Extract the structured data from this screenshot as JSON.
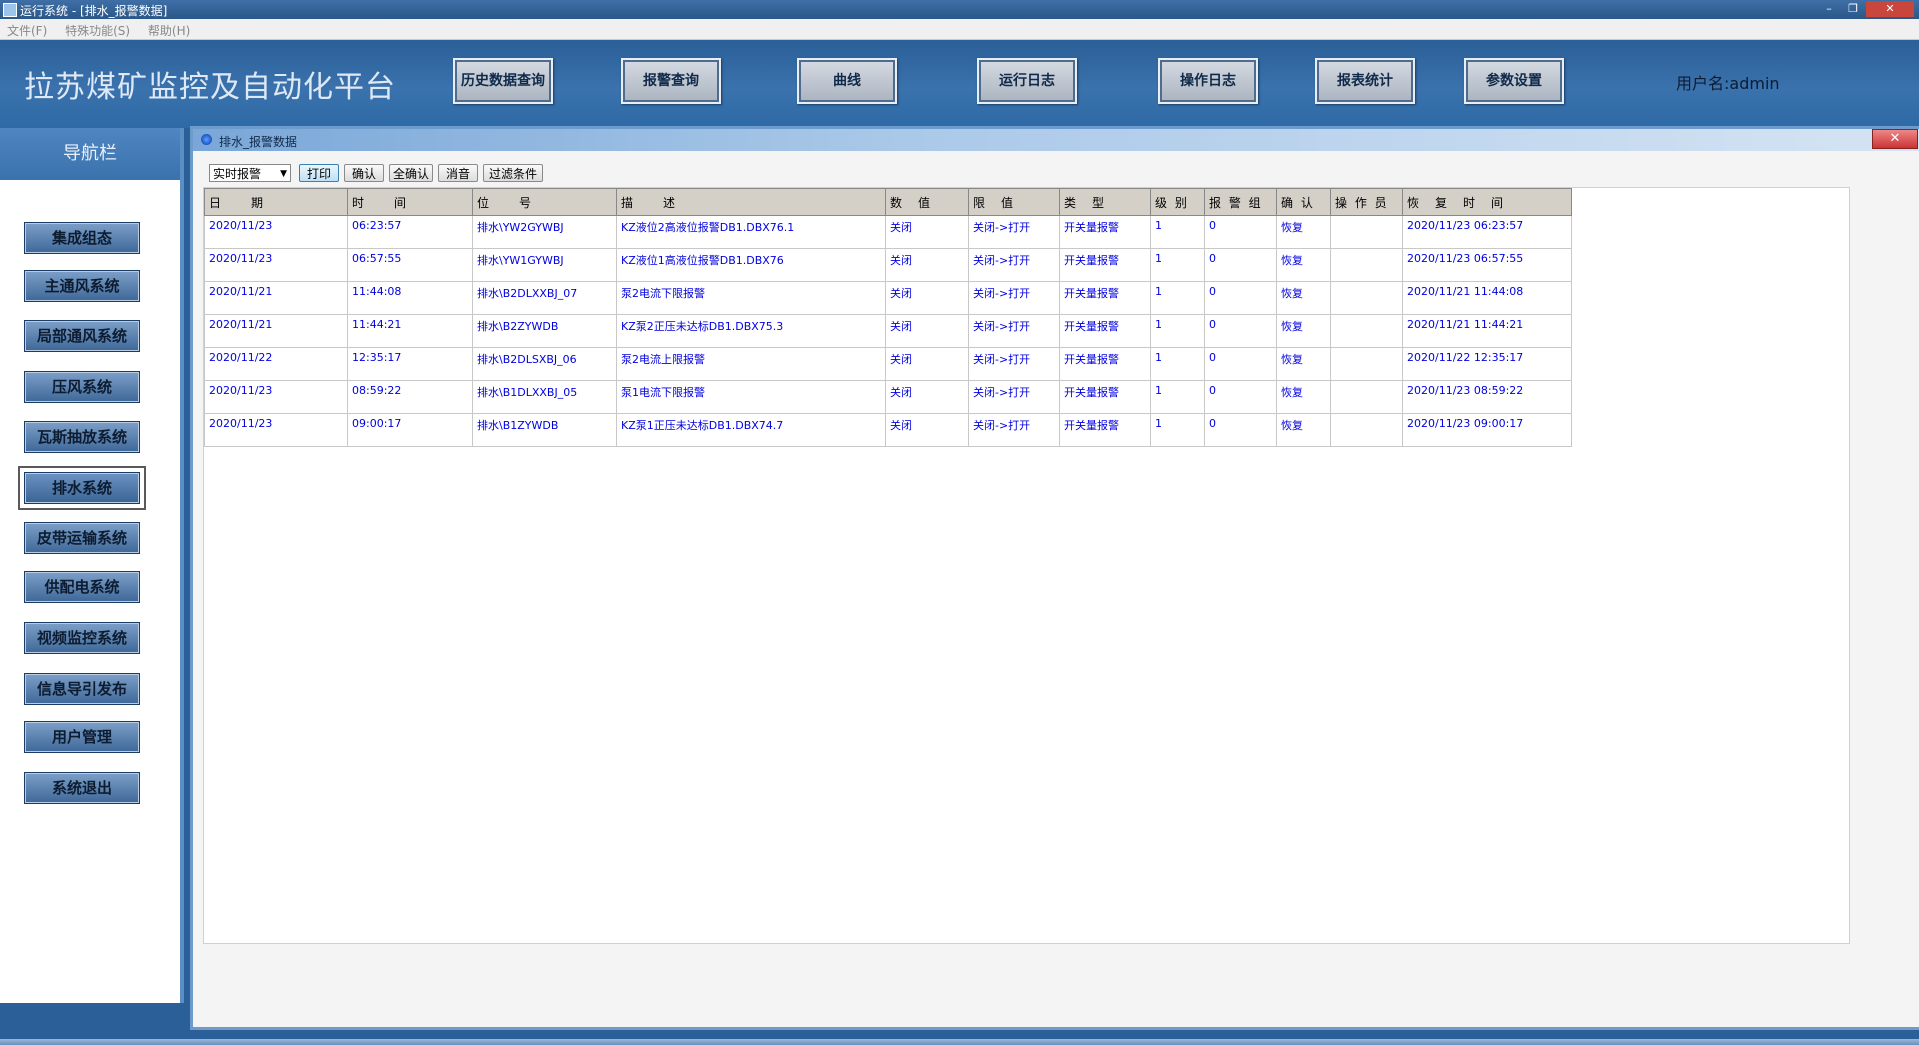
{
  "window": {
    "title": "运行系统 - [排水_报警数据]",
    "controls": [
      "–",
      "❐",
      "✕"
    ]
  },
  "menu": [
    "文件(F)",
    "特殊功能(S)",
    "帮助(H)"
  ],
  "header": {
    "platform_title": "拉苏煤矿监控及自动化平台",
    "buttons": [
      "历史数据查询",
      "报警查询",
      "曲线",
      "运行日志",
      "操作日志",
      "报表统计",
      "参数设置"
    ],
    "user": "用户名:admin"
  },
  "sidebar": {
    "title": "导航栏",
    "items": [
      "集成组态",
      "主通风系统",
      "局部通风系统",
      "压风系统",
      "瓦斯抽放系统",
      "排水系统",
      "皮带运输系统",
      "供配电系统",
      "视频监控系统",
      "信息导引发布",
      "用户管理",
      "系统退出"
    ],
    "active": "排水系统"
  },
  "alarm_window": {
    "title": "排水_报警数据",
    "close": "✕",
    "toolbar": {
      "mode_select": "实时报警",
      "buttons": [
        "打印",
        "确认",
        "全确认",
        "消音",
        "过滤条件"
      ]
    },
    "columns": [
      "日　　期",
      "时　　间",
      "位　　号",
      "描　　述",
      "数　值",
      "限　值",
      "类　型",
      "级 别",
      "报 警 组",
      "确 认",
      "操 作 员",
      "恢　复　时　间"
    ],
    "rows": [
      [
        "2020/11/23",
        "06:23:57",
        "排水\\YW2GYWBJ",
        "KZ液位2高液位报警DB1.DBX76.1",
        "关闭",
        "关闭->打开",
        "开关量报警",
        "1",
        "0",
        "恢复",
        "",
        "2020/11/23 06:23:57"
      ],
      [
        "2020/11/23",
        "06:57:55",
        "排水\\YW1GYWBJ",
        "KZ液位1高液位报警DB1.DBX76",
        "关闭",
        "关闭->打开",
        "开关量报警",
        "1",
        "0",
        "恢复",
        "",
        "2020/11/23 06:57:55"
      ],
      [
        "2020/11/21",
        "11:44:08",
        "排水\\B2DLXXBJ_07",
        "泵2电流下限报警",
        "关闭",
        "关闭->打开",
        "开关量报警",
        "1",
        "0",
        "恢复",
        "",
        "2020/11/21 11:44:08"
      ],
      [
        "2020/11/21",
        "11:44:21",
        "排水\\B2ZYWDB",
        "KZ泵2正压未达标DB1.DBX75.3",
        "关闭",
        "关闭->打开",
        "开关量报警",
        "1",
        "0",
        "恢复",
        "",
        "2020/11/21 11:44:21"
      ],
      [
        "2020/11/22",
        "12:35:17",
        "排水\\B2DLSXBJ_06",
        "泵2电流上限报警",
        "关闭",
        "关闭->打开",
        "开关量报警",
        "1",
        "0",
        "恢复",
        "",
        "2020/11/22 12:35:17"
      ],
      [
        "2020/11/23",
        "08:59:22",
        "排水\\B1DLXXBJ_05",
        "泵1电流下限报警",
        "关闭",
        "关闭->打开",
        "开关量报警",
        "1",
        "0",
        "恢复",
        "",
        "2020/11/23 08:59:22"
      ],
      [
        "2020/11/23",
        "09:00:17",
        "排水\\B1ZYWDB",
        "KZ泵1正压未达标DB1.DBX74.7",
        "关闭",
        "关闭->打开",
        "开关量报警",
        "1",
        "0",
        "恢复",
        "",
        "2020/11/23 09:00:17"
      ]
    ]
  }
}
